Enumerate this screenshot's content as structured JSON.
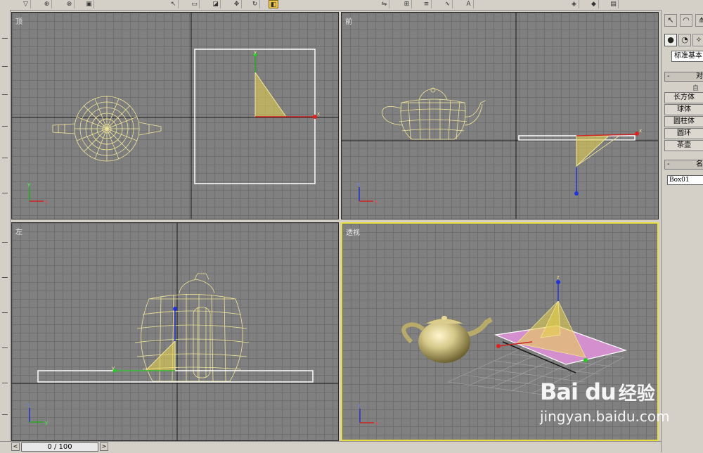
{
  "viewports": {
    "top": {
      "label": "顶"
    },
    "front": {
      "label": "前"
    },
    "left": {
      "label": "左"
    },
    "perspective": {
      "label": "透视"
    }
  },
  "command_panel": {
    "category_dropdown": "标准基本",
    "rollout_object_type": {
      "title": "对",
      "sub": "自"
    },
    "object_buttons": [
      "长方体",
      "球体",
      "圆柱体",
      "圆环",
      "茶壶"
    ],
    "rollout_name": {
      "title": "名"
    },
    "name_field": "Box01"
  },
  "timeline": {
    "slider": "0 / 100",
    "prev": "<",
    "next": ">"
  },
  "axis_labels": {
    "x": "x",
    "y": "y",
    "z": "z"
  },
  "watermark": {
    "logo": "Bai du",
    "cn": "经验",
    "url": "jingyan.baidu.com"
  },
  "colors": {
    "viewport_bg": "#808080",
    "grid": "#6f6f6f",
    "wire_yellow": "#f2e69a",
    "active_border": "#e8e040",
    "plane_pink": "#d48fcf"
  }
}
